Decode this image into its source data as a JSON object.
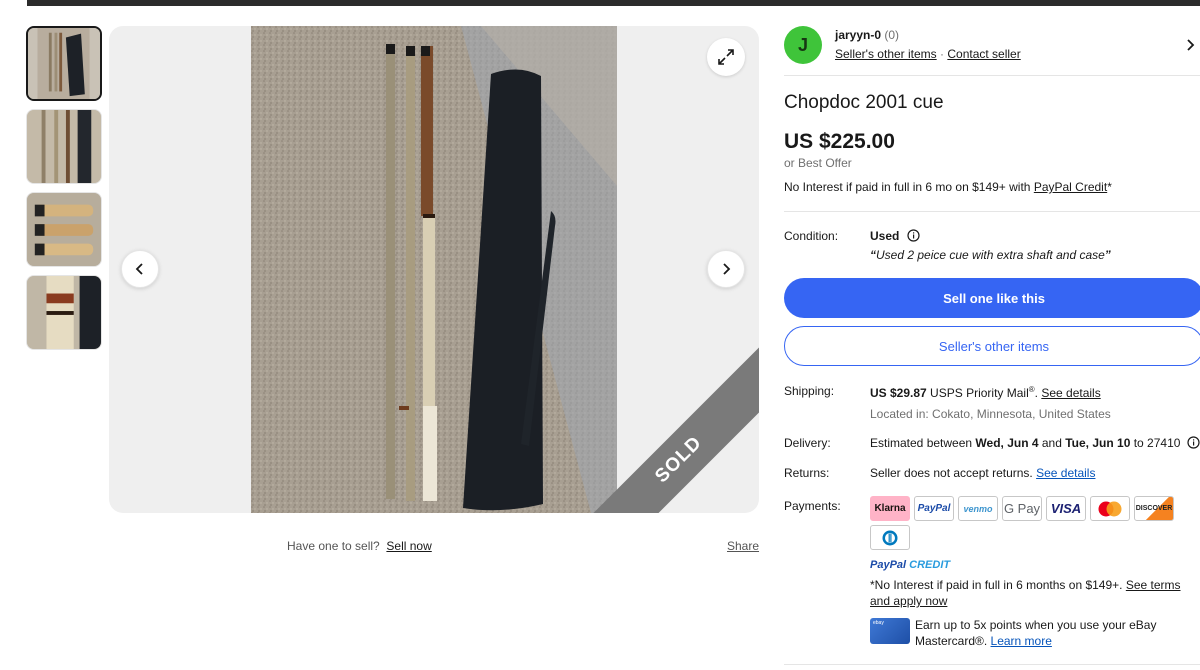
{
  "gallery": {
    "thumbnail_count": 4,
    "sold_label": "SOLD",
    "have_one": "Have one to sell?",
    "sell_now": "Sell now",
    "share": "Share"
  },
  "seller": {
    "initial": "J",
    "name": "jaryyn-0",
    "feedback": "(0)",
    "other_items": "Seller's other items",
    "separator": "·",
    "contact": "Contact seller"
  },
  "item": {
    "title": "Chopdoc 2001 cue",
    "price": "US $225.00",
    "best_offer": "or Best Offer",
    "no_interest_prefix": "No Interest if paid in full in 6 mo on $149+ with ",
    "paypal_credit_link": "PayPal Credit",
    "no_interest_suffix": "*"
  },
  "condition": {
    "label": "Condition:",
    "value": "Used",
    "quote_open": "“",
    "description": "Used 2 peice cue with extra shaft and case",
    "quote_close": "”"
  },
  "buttons": {
    "sell_one": "Sell one like this",
    "sellers_items": "Seller's other items"
  },
  "shipping": {
    "label": "Shipping:",
    "cost": "US $29.87",
    "service": " USPS Priority Mail",
    "reg": "®",
    "period": ". ",
    "details_link": "See details",
    "location": "Located in: Cokato, Minnesota, United States"
  },
  "delivery": {
    "label": "Delivery:",
    "prefix": "Estimated between ",
    "start": "Wed, Jun 4",
    "and": " and ",
    "end": "Tue, Jun 10",
    "to": " to 27410"
  },
  "returns": {
    "label": "Returns:",
    "text": "Seller does not accept returns. ",
    "details_link": "See details"
  },
  "payments": {
    "label": "Payments:",
    "methods": [
      "Klarna",
      "PayPal",
      "venmo",
      "G Pay",
      "VISA",
      "Mastercard",
      "DISCOVER",
      "Diners Club"
    ],
    "paypal_credit_a": "PayPal",
    "paypal_credit_b": "CREDIT",
    "terms_text": "*No Interest if paid in full in 6 months on $149+. ",
    "terms_link": "See terms and apply now",
    "mc_card_label": "ebay",
    "mc_text": "Earn up to 5x points when you use your eBay Mastercard®. ",
    "mc_link": "Learn more"
  }
}
